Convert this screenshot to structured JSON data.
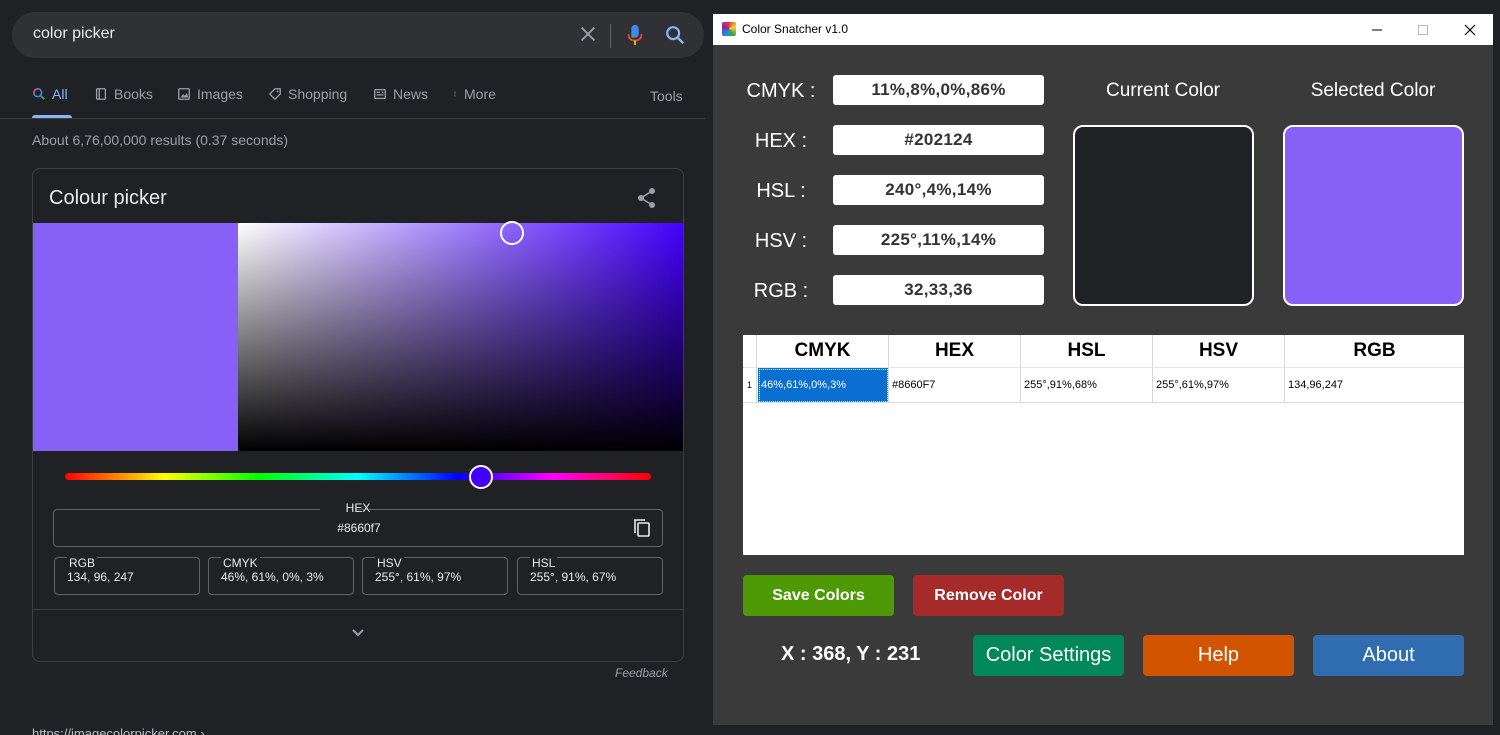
{
  "search": {
    "query": "color picker",
    "tabs": [
      {
        "label": "All",
        "icon": "search-icon",
        "active": true
      },
      {
        "label": "Books",
        "icon": "book-icon"
      },
      {
        "label": "Images",
        "icon": "image-icon"
      },
      {
        "label": "Shopping",
        "icon": "tag-icon"
      },
      {
        "label": "News",
        "icon": "news-icon"
      },
      {
        "label": "More",
        "icon": "more-vert-icon"
      }
    ],
    "tools_label": "Tools",
    "results_count": "About 6,76,00,000 results (0.37 seconds)",
    "feedback": "Feedback",
    "bottom_url": "https://imagecolorpicker.com › ..."
  },
  "picker": {
    "title": "Colour picker",
    "color": "#8660f7",
    "hue_color": "#4400ff",
    "hex_label": "HEX",
    "hex_value": "#8660f7",
    "fields": [
      {
        "label": "RGB",
        "value": "134, 96, 247"
      },
      {
        "label": "CMYK",
        "value": "46%, 61%, 0%, 3%"
      },
      {
        "label": "HSV",
        "value": "255°, 61%, 97%"
      },
      {
        "label": "HSL",
        "value": "255°, 91%, 67%"
      }
    ]
  },
  "app": {
    "title": "Color Snatcher v1.0",
    "fields": [
      {
        "label": "CMYK :",
        "value": "11%,8%,0%,86%"
      },
      {
        "label": "HEX :",
        "value": "#202124"
      },
      {
        "label": "HSL :",
        "value": "240°,4%,14%"
      },
      {
        "label": "HSV :",
        "value": "225°,11%,14%"
      },
      {
        "label": "RGB :",
        "value": "32,33,36"
      }
    ],
    "current_color_label": "Current Color",
    "selected_color_label": "Selected Color",
    "current_color": "#202124",
    "selected_color": "#8660f7",
    "table": {
      "headers": [
        "CMYK",
        "HEX",
        "HSL",
        "HSV",
        "RGB"
      ],
      "rows": [
        {
          "num": "1",
          "cells": [
            "46%,61%,0%,3%",
            "#8660F7",
            "255°,91%,68%",
            "255°,61%,97%",
            "134,96,247"
          ]
        }
      ]
    },
    "buttons": {
      "save": "Save Colors",
      "remove": "Remove Color",
      "settings": "Color Settings",
      "help": "Help",
      "about": "About"
    },
    "button_colors": {
      "save": "#4e9a06",
      "remove": "#a52a2a",
      "settings": "#00875a",
      "help": "#d35400",
      "about": "#2f6db0"
    },
    "coords": "X : 368, Y : 231"
  }
}
